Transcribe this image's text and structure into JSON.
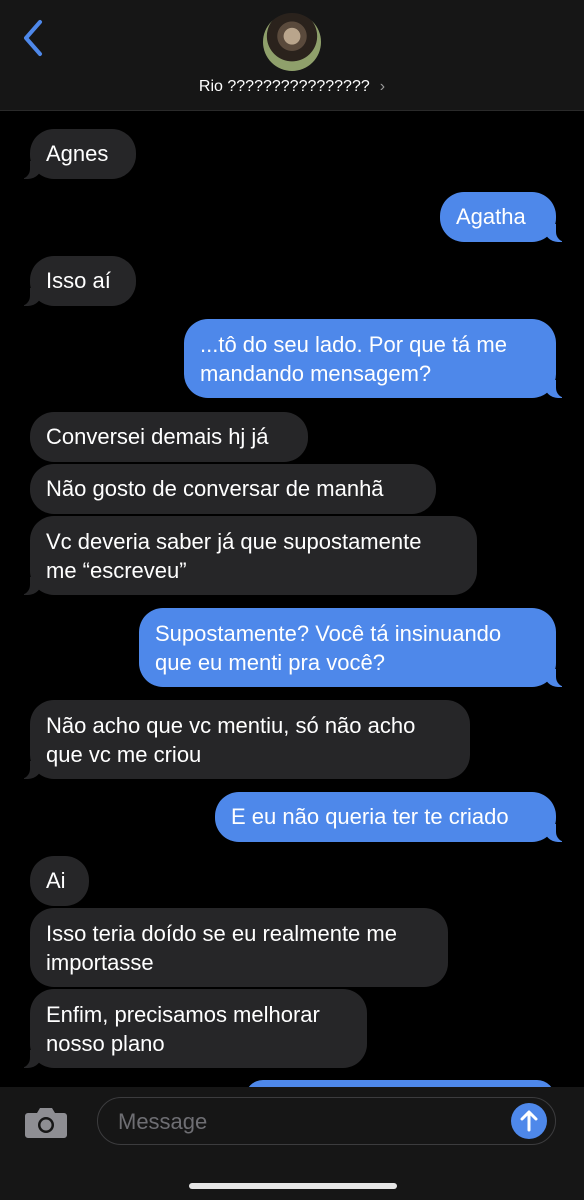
{
  "header": {
    "back_icon": "chevron-left-icon",
    "contact_name": "Rio ????????????????",
    "chevron": "›"
  },
  "colors": {
    "accent": "#4e88ea",
    "incoming_bubble": "#262628",
    "background": "#000000"
  },
  "messages": [
    {
      "side": "in",
      "lines": [
        "Agnes"
      ]
    },
    {
      "side": "out",
      "lines": [
        "Agatha"
      ]
    },
    {
      "side": "in",
      "lines": [
        "Isso aí"
      ]
    },
    {
      "side": "out",
      "lines": [
        "...tô do seu lado. Por que tá me",
        "mandando mensagem?"
      ]
    },
    {
      "side": "in",
      "lines": [
        "Conversei demais hj já"
      ]
    },
    {
      "side": "in",
      "lines": [
        "Não gosto de conversar de manhã"
      ]
    },
    {
      "side": "in",
      "lines": [
        "Vc deveria saber já que supostamente",
        "me “escreveu”"
      ]
    },
    {
      "side": "out",
      "lines": [
        "Supostamente? Você tá insinuando",
        "que eu menti pra você?"
      ]
    },
    {
      "side": "in",
      "lines": [
        "Não acho que vc mentiu, só não acho",
        "que vc me criou"
      ]
    },
    {
      "side": "out",
      "lines": [
        "E eu não queria ter te criado"
      ]
    },
    {
      "side": "in",
      "lines": [
        "Ai"
      ]
    },
    {
      "side": "in",
      "lines": [
        "Isso teria doído se eu realmente me",
        "importasse"
      ]
    },
    {
      "side": "in",
      "lines": [
        "Enfim, precisamos melhorar",
        "nosso plano"
      ]
    }
  ],
  "composer": {
    "placeholder": "Message",
    "camera_icon": "camera-icon",
    "send_icon": "arrow-up-icon"
  }
}
